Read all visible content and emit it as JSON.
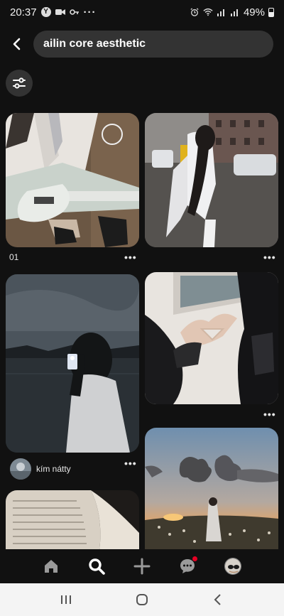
{
  "status_bar": {
    "time": "20:37",
    "battery": "49%",
    "overflow_dots": "···"
  },
  "search": {
    "query": "ailin core aesthetic"
  },
  "pins": [
    {
      "caption": "01",
      "more": "•••"
    },
    {
      "more": "•••"
    },
    {
      "creator": "kím nátty",
      "more": "•••"
    },
    {
      "more": "•••"
    }
  ],
  "nav": {
    "items": [
      "home-icon",
      "search-icon",
      "plus-icon",
      "messages-icon",
      "profile-avatar"
    ],
    "active": "search-icon",
    "notification_color": "#e60023"
  },
  "system_nav": [
    "recents-icon",
    "home-circle-icon",
    "back-chevron-icon"
  ]
}
